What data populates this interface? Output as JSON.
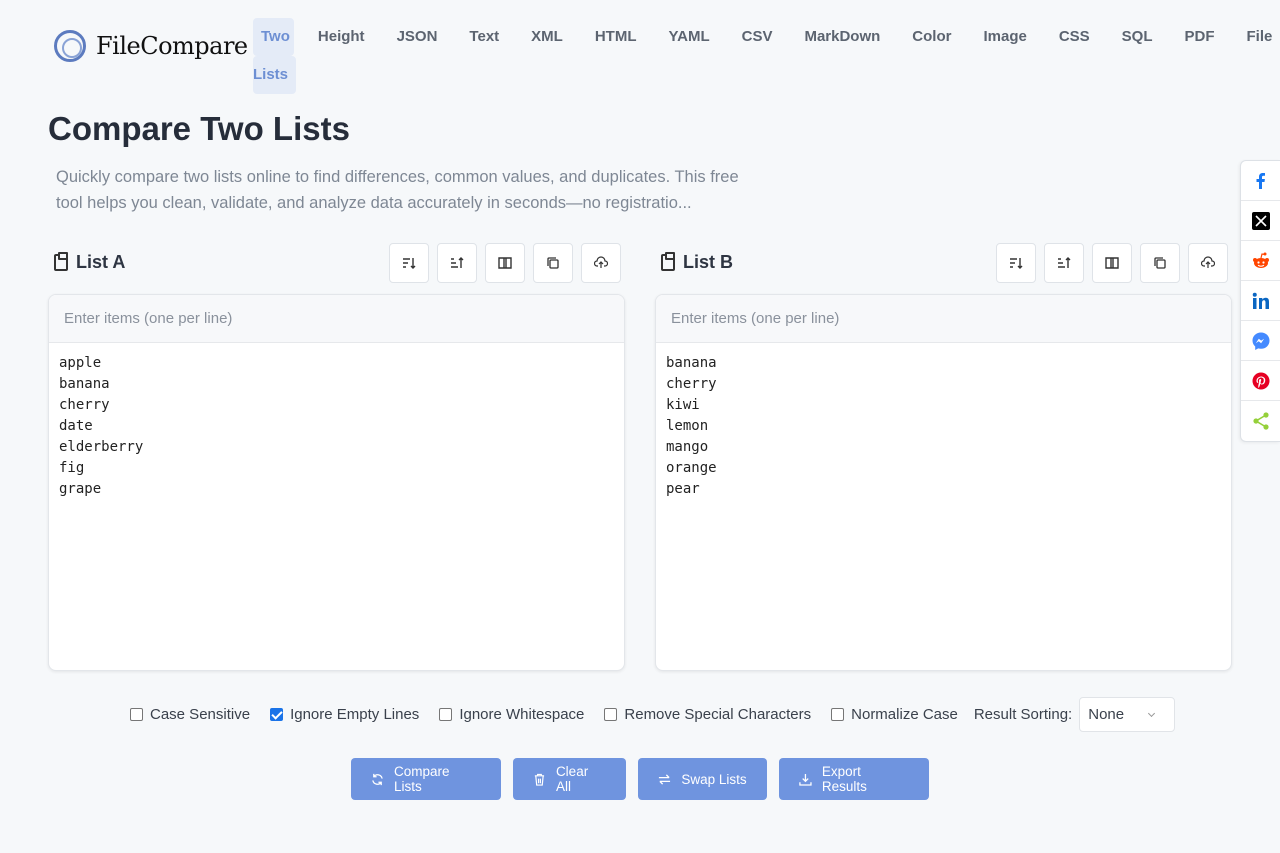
{
  "brand": {
    "name": "FileCompare"
  },
  "nav": {
    "items": [
      "Two",
      "Lists",
      "Height",
      "JSON",
      "Text",
      "XML",
      "HTML",
      "YAML",
      "CSV",
      "MarkDown",
      "Color",
      "Image",
      "CSS",
      "SQL",
      "PDF",
      "File"
    ]
  },
  "page": {
    "title": "Compare Two Lists",
    "description": "Quickly compare two lists online to find differences, common values, and duplicates. This free tool helps you clean, validate, and analyze data accurately in seconds—no registratio..."
  },
  "list_a": {
    "title": "List A",
    "placeholder": "Enter items (one per line)",
    "lines": [
      "apple",
      "banana",
      "cherry",
      "date",
      "elderberry",
      "fig",
      "grape"
    ]
  },
  "list_b": {
    "title": "List B",
    "placeholder": "Enter items (one per line)",
    "lines": [
      "banana",
      "cherry",
      "kiwi",
      "lemon",
      "mango",
      "orange",
      "pear"
    ]
  },
  "options": {
    "case_sensitive": {
      "label": "Case Sensitive",
      "checked": false
    },
    "ignore_empty": {
      "label": "Ignore Empty Lines",
      "checked": true
    },
    "ignore_whitespace": {
      "label": "Ignore Whitespace",
      "checked": false
    },
    "remove_special": {
      "label": "Remove Special Characters",
      "checked": false
    },
    "normalize_case": {
      "label": "Normalize Case",
      "checked": false
    },
    "sorting_label": "Result Sorting:",
    "sorting_value": "None"
  },
  "actions": {
    "compare": "Compare Lists",
    "clear": "Clear All",
    "swap": "Swap Lists",
    "export": "Export Results"
  },
  "colors": {
    "accent": "#6f94df",
    "nav_active_bg": "#e4ebf7",
    "nav_active_text": "#6d8fd3",
    "facebook": "#1877f2",
    "reddit": "#ff4500",
    "linkedin": "#0a66c2",
    "messenger": "#448aff",
    "pinterest": "#e60023",
    "sharethis": "#95d03a"
  },
  "share_icons": [
    "facebook-icon",
    "x-icon",
    "reddit-icon",
    "linkedin-icon",
    "messenger-icon",
    "pinterest-icon",
    "share-icon"
  ]
}
